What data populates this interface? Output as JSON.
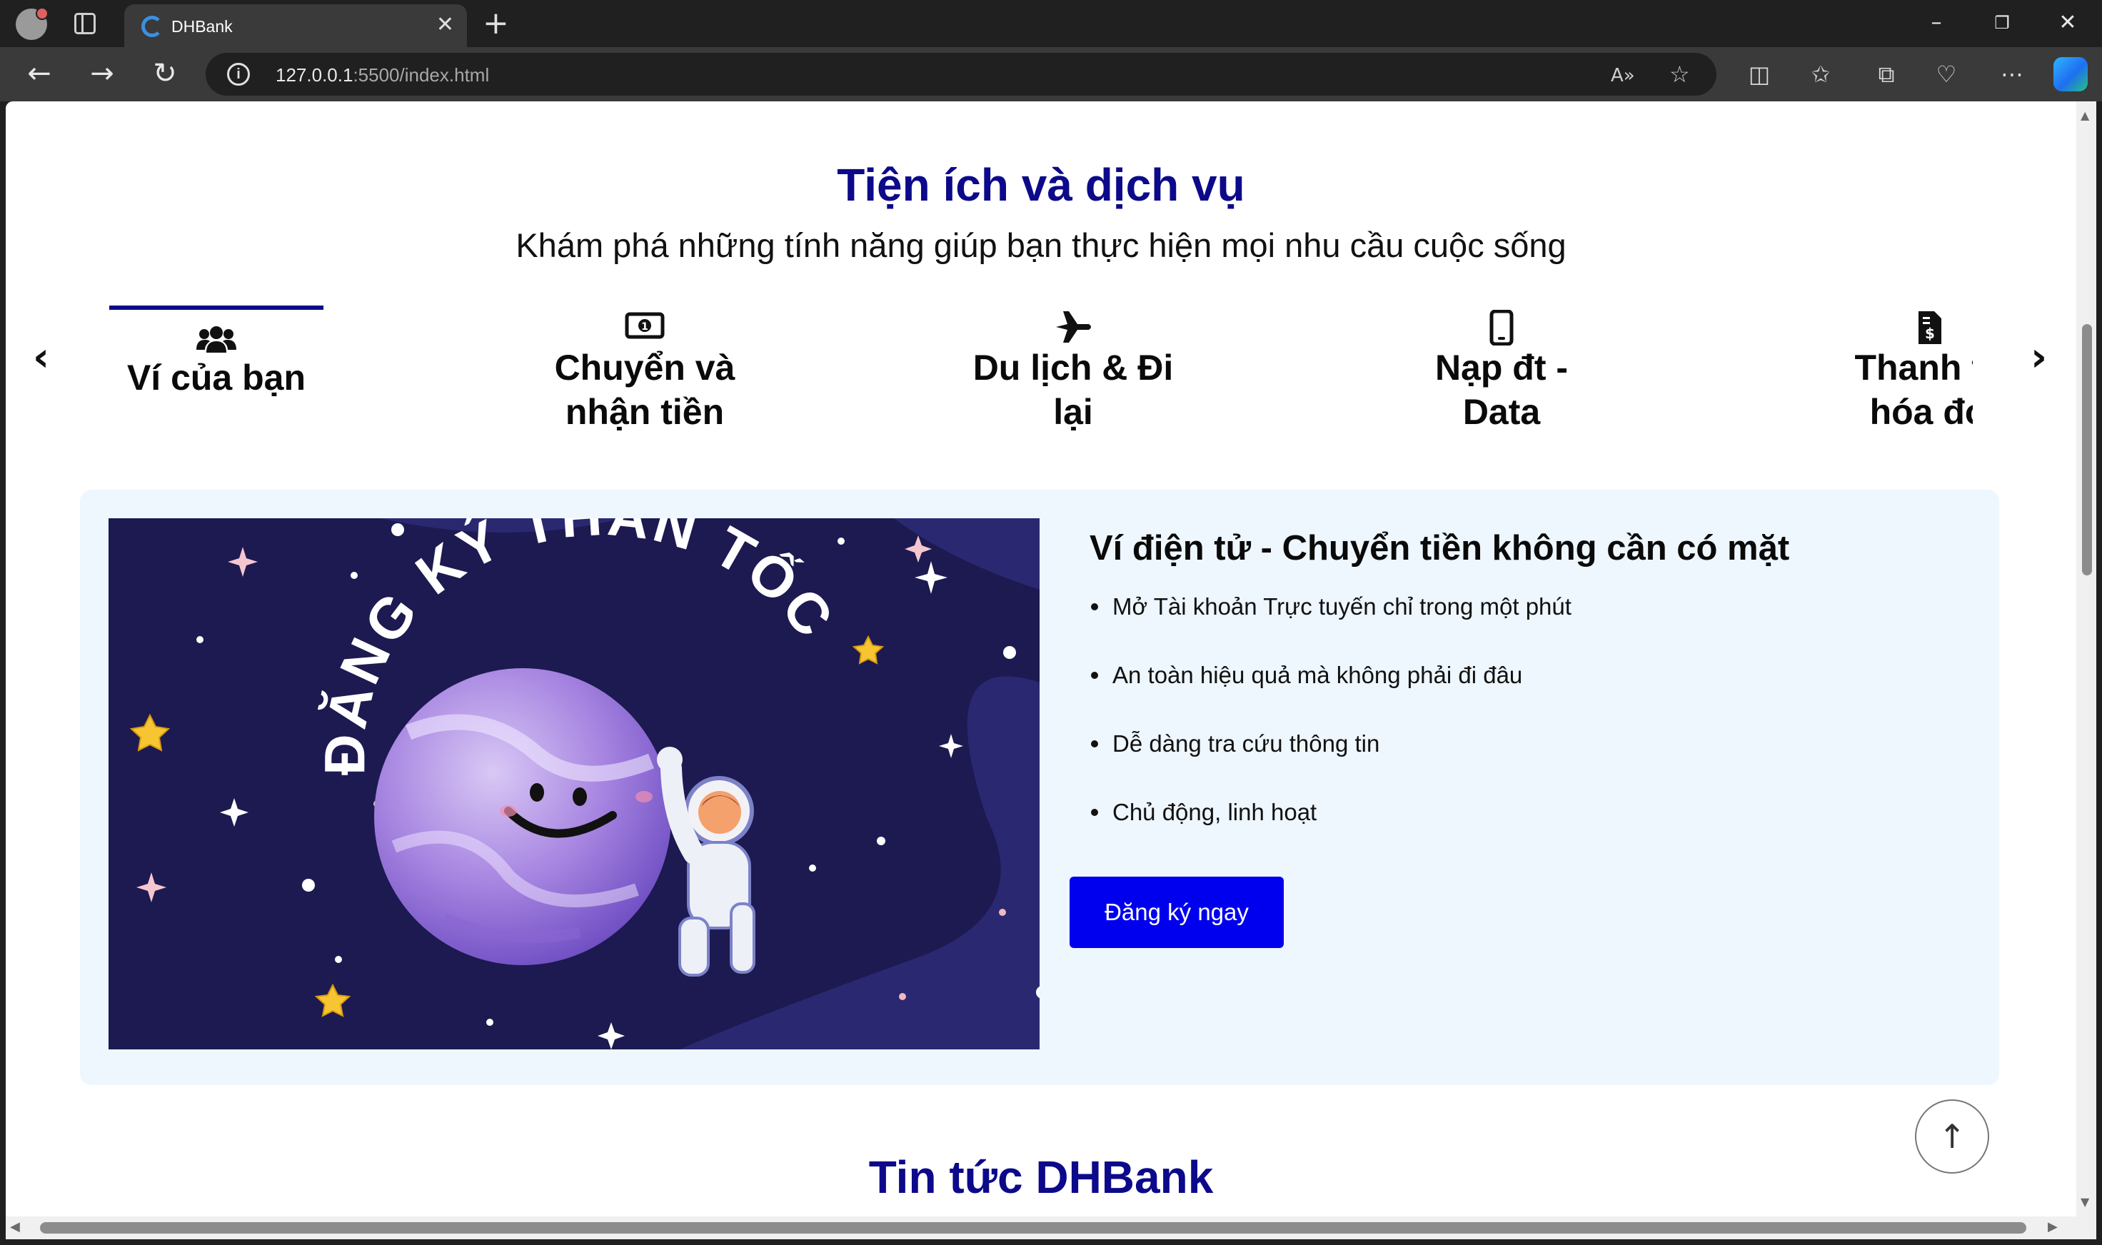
{
  "browser": {
    "tab_title": "DHBank",
    "url_host": "127.0.0.1",
    "url_rest": ":5500/index.html"
  },
  "section": {
    "title": "Tiện ích và dịch vụ",
    "subtitle": "Khám phá những tính năng giúp bạn thực hiện mọi nhu cầu cuộc sống",
    "prev": "‹",
    "next": "›",
    "tabs": [
      {
        "label_line1": "Ví của bạn",
        "label_line2": "",
        "icon": "users-icon",
        "active": true
      },
      {
        "label_line1": "Chuyển và",
        "label_line2": "nhận tiền",
        "icon": "money-bill-icon",
        "active": false
      },
      {
        "label_line1": "Du lịch & Đi",
        "label_line2": "lại",
        "icon": "plane-icon",
        "active": false
      },
      {
        "label_line1": "Nạp đt -",
        "label_line2": "Data",
        "icon": "mobile-icon",
        "active": false
      },
      {
        "label_line1": "Thanh to",
        "label_line2": "hóa đơ",
        "icon": "invoice-dollar-icon",
        "active": false
      }
    ]
  },
  "detail": {
    "banner_text": "ĐĂNG KÝ THẦN TỐC",
    "title": "Ví điện tử - Chuyển tiền không cần có mặt",
    "features": [
      "Mở Tài khoản Trực tuyến chỉ trong một phút",
      "An toàn hiệu quả mà không phải đi đâu",
      "Dễ dàng tra cứu thông tin",
      "Chủ động, linh hoạt"
    ],
    "cta_label": "Đăng ký ngay"
  },
  "news": {
    "title": "Tin tức DHBank"
  },
  "colors": {
    "brand": "#0c0a8a",
    "cta": "#0000ee",
    "card_bg": "#eef6fe",
    "banner_bg": "#1c1a50"
  }
}
